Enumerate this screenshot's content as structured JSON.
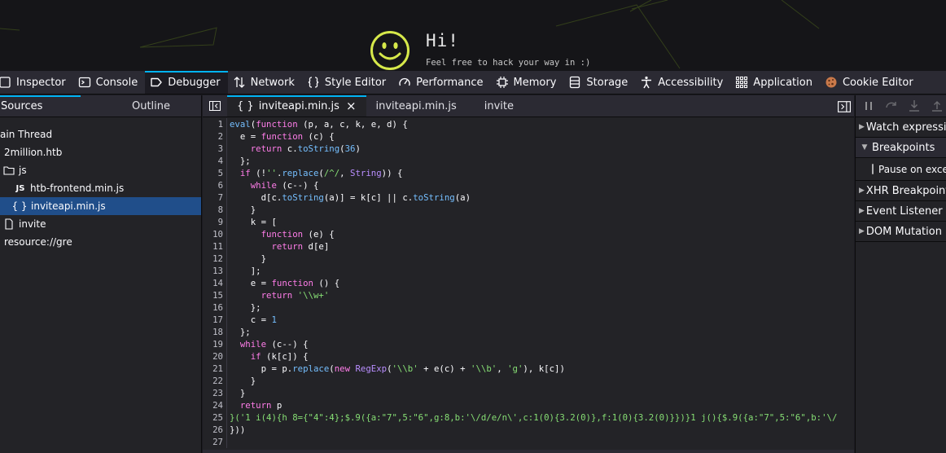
{
  "site": {
    "greeting": "Hi!",
    "subtitle": "Feel free to hack your way in :)"
  },
  "toolbar": {
    "tabs": [
      {
        "label": "Inspector",
        "icon": "inspector-icon"
      },
      {
        "label": "Console",
        "icon": "console-icon"
      },
      {
        "label": "Debugger",
        "icon": "debugger-icon",
        "active": true
      },
      {
        "label": "Network",
        "icon": "network-icon"
      },
      {
        "label": "Style Editor",
        "icon": "style-editor-icon"
      },
      {
        "label": "Performance",
        "icon": "performance-icon"
      },
      {
        "label": "Memory",
        "icon": "memory-icon"
      },
      {
        "label": "Storage",
        "icon": "storage-icon"
      },
      {
        "label": "Accessibility",
        "icon": "accessibility-icon"
      },
      {
        "label": "Application",
        "icon": "application-icon"
      },
      {
        "label": "Cookie Editor",
        "icon": "cookie-icon"
      }
    ]
  },
  "left_panel": {
    "tabs": [
      "Sources",
      "Outline"
    ],
    "tree": [
      {
        "label": "ain Thread",
        "indent": 0,
        "icon": ""
      },
      {
        "label": "2million.htb",
        "indent": 5,
        "icon": ""
      },
      {
        "label": "js",
        "indent": 5,
        "icon": "folder-icon"
      },
      {
        "label": "htb-frontend.min.js",
        "indent": 20,
        "icon": "js-file-icon"
      },
      {
        "label": "inviteapi.min.js",
        "indent": 18,
        "icon": "braces-icon",
        "selected": true
      },
      {
        "label": "invite",
        "indent": 5,
        "icon": "file-icon"
      },
      {
        "label": "resource://gre",
        "indent": 5,
        "icon": ""
      }
    ]
  },
  "editor": {
    "tabs": [
      {
        "label": "inviteapi.min.js",
        "pretty": true,
        "active": true
      },
      {
        "label": "inviteapi.min.js"
      },
      {
        "label": "invite"
      }
    ],
    "close_glyph": "×",
    "braces_glyph": "{ }",
    "code_lines": [
      "eval(function (p, a, c, k, e, d) {",
      "  e = function (c) {",
      "    return c.toString(36)",
      "  };",
      "  if (!''.replace(/^/, String)) {",
      "    while (c--) {",
      "      d[c.toString(a)] = k[c] || c.toString(a)",
      "    }",
      "    k = [",
      "      function (e) {",
      "        return d[e]",
      "      }",
      "    ];",
      "    e = function () {",
      "      return '\\\\w+'",
      "    };",
      "    c = 1",
      "  };",
      "  while (c--) {",
      "    if (k[c]) {",
      "      p = p.replace(new RegExp('\\\\b' + e(c) + '\\\\b', 'g'), k[c])",
      "    }",
      "  }",
      "  return p",
      "}('1 i(4){h 8={\"4\":4};$.9({a:\"7\",5:\"6\",g:8,b:'\\/d/e/n\\',c:1(0){3.2(0)},f:1(0){3.2(0)}})}1 j(){$.9({a:\"7\",5:\"6\",b:'\\/",
      "}))",
      ""
    ]
  },
  "right_panel": {
    "sections": [
      {
        "label": "Watch expressions",
        "expanded": false
      },
      {
        "label": "Breakpoints",
        "expanded": true
      },
      {
        "label": "XHR Breakpoints",
        "expanded": false
      },
      {
        "label": "Event Listener Breakpoints",
        "expanded": false
      },
      {
        "label": "DOM Mutation Breakpoints",
        "expanded": false
      }
    ],
    "pause_on_exceptions": "Pause on exceptions"
  },
  "colors": {
    "accent": "#00b3f4",
    "selected_row": "#204e8a",
    "toolbar_bg": "#2b2a33",
    "panel_bg": "#232327"
  }
}
